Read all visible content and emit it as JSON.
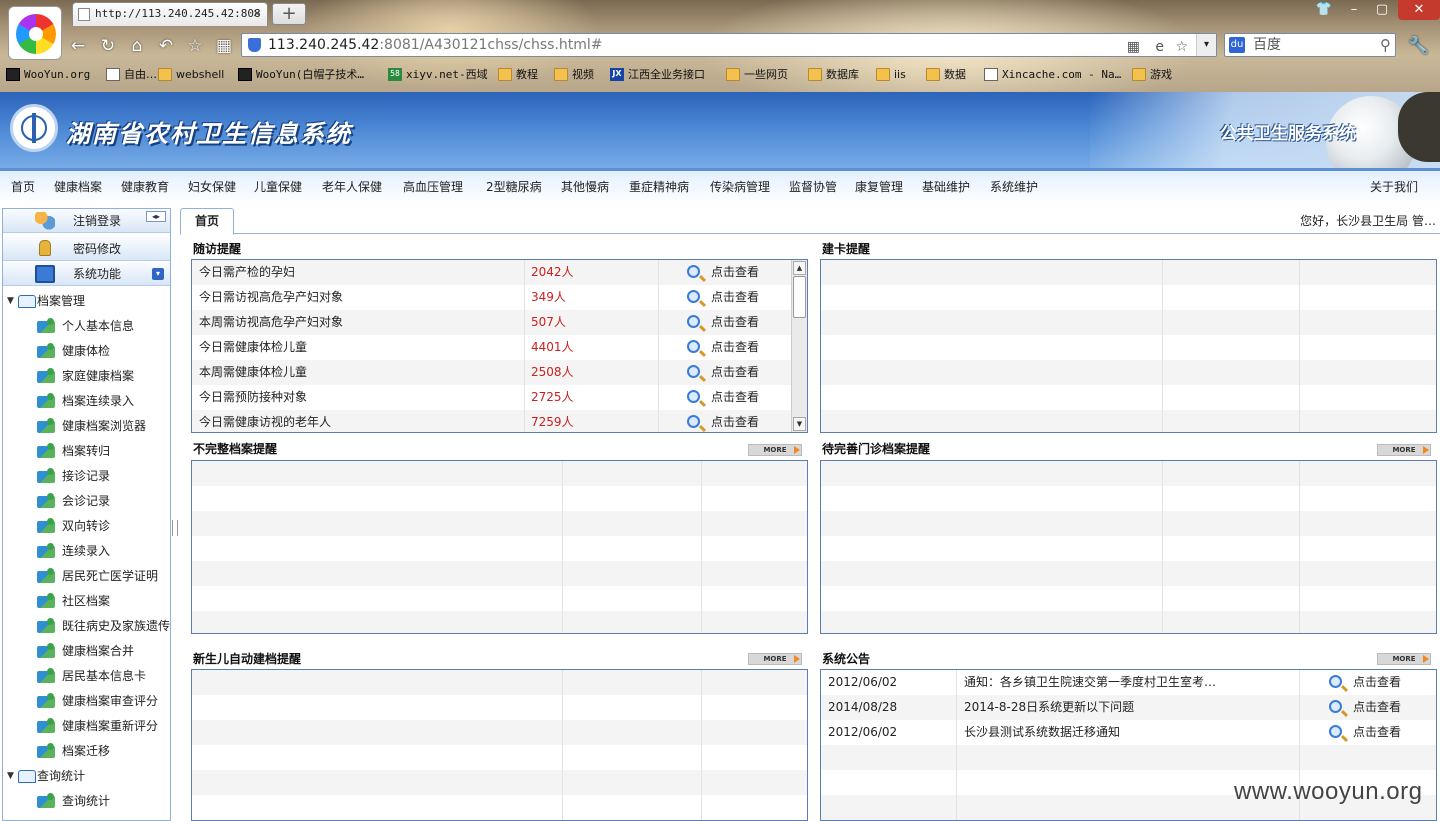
{
  "browser": {
    "tab_title": "http://113.240.245.42:808",
    "tab_close": "✕",
    "new_tab": "+",
    "url_host": "113.240.245.42",
    "url_path": ":8081/A430121chss/chss.html#",
    "search_placeholder": "百度",
    "search_logo": "du",
    "win_buttons": {
      "skin": "👕",
      "minimize": "–",
      "maximize": "▢",
      "close": "✕"
    },
    "nav_icons": {
      "back": "←",
      "reload": "↻",
      "home": "⌂",
      "undo": "↶",
      "favorite": "☆",
      "grid": "▦",
      "wrench": "🔧"
    },
    "addr_icons": {
      "qr": "▦",
      "ie": "e",
      "star": "☆",
      "drop": "▾",
      "mag": "⚲"
    },
    "bookmarks": [
      {
        "label": "WooYun.org",
        "icon": "mono-icon"
      },
      {
        "label": "自由…",
        "icon": "page-icon"
      },
      {
        "label": "webshell",
        "icon": "folder-icon"
      },
      {
        "label": "WooYun(白帽子技术…",
        "icon": "mono-icon"
      },
      {
        "label": "xiyv.net-西域",
        "icon": "number-icon",
        "badge": "58"
      },
      {
        "label": "教程",
        "icon": "folder-icon"
      },
      {
        "label": "视频",
        "icon": "folder-icon"
      },
      {
        "label": "江西全业务接口",
        "icon": "jx-icon",
        "badge": "JX"
      },
      {
        "label": "一些网页",
        "icon": "folder-icon"
      },
      {
        "label": "数据库",
        "icon": "folder-icon"
      },
      {
        "label": "iis",
        "icon": "folder-icon"
      },
      {
        "label": "数据",
        "icon": "folder-icon"
      },
      {
        "label": "Xincache.com - Na…",
        "icon": "page-icon"
      },
      {
        "label": "游戏",
        "icon": "folder-icon"
      }
    ]
  },
  "banner": {
    "title": "湖南省农村卫生信息系统",
    "subtitle": "公共卫生服务系统"
  },
  "menu": {
    "items": [
      "首页",
      "健康档案",
      "健康教育",
      "妇女保健",
      "儿童保健",
      "老年人保健",
      "高血压管理",
      "2型糖尿病",
      "其他慢病",
      "重症精神病",
      "传染病管理",
      "监督协管",
      "康复管理",
      "基础维护",
      "系统维护"
    ],
    "about": "关于我们"
  },
  "sidebar": {
    "buttons": [
      {
        "label": "注销登录",
        "icon": "users-icon"
      },
      {
        "label": "密码修改",
        "icon": "lock-icon"
      },
      {
        "label": "系统功能",
        "icon": "computer-icon"
      }
    ],
    "collapse_arrows": "◂▸",
    "expand_arrow": "▾",
    "tree": [
      {
        "label": "档案管理",
        "level": 0
      },
      {
        "label": "个人基本信息",
        "level": 1
      },
      {
        "label": "健康体检",
        "level": 1
      },
      {
        "label": "家庭健康档案",
        "level": 1
      },
      {
        "label": "档案连续录入",
        "level": 1
      },
      {
        "label": "健康档案浏览器",
        "level": 1
      },
      {
        "label": "档案转归",
        "level": 1
      },
      {
        "label": "接诊记录",
        "level": 1
      },
      {
        "label": "会诊记录",
        "level": 1
      },
      {
        "label": "双向转诊",
        "level": 1
      },
      {
        "label": "连续录入",
        "level": 1
      },
      {
        "label": "居民死亡医学证明",
        "level": 1
      },
      {
        "label": "社区档案",
        "level": 1
      },
      {
        "label": "既往病史及家族遗传",
        "level": 1
      },
      {
        "label": "健康档案合并",
        "level": 1
      },
      {
        "label": "居民基本信息卡",
        "level": 1
      },
      {
        "label": "健康档案审查评分",
        "level": 1
      },
      {
        "label": "健康档案重新评分",
        "level": 1
      },
      {
        "label": "档案迁移",
        "level": 1
      },
      {
        "label": "查询统计",
        "level": 0
      },
      {
        "label": "查询统计",
        "level": 1
      }
    ],
    "toggle_glyph": "▼"
  },
  "main": {
    "tab": "首页",
    "greeting": "您好，长沙县卫生局 管…",
    "more_label": "MORE",
    "panels": {
      "followup": {
        "title": "随访提醒",
        "view_label": "点击查看",
        "rows": [
          {
            "name": "今日需产检的孕妇",
            "count": "2042人"
          },
          {
            "name": "今日需访视高危孕产妇对象",
            "count": "349人"
          },
          {
            "name": "本周需访视高危孕产妇对象",
            "count": "507人"
          },
          {
            "name": "今日需健康体检儿童",
            "count": "4401人"
          },
          {
            "name": "本周需健康体检儿童",
            "count": "2508人"
          },
          {
            "name": "今日需预防接种对象",
            "count": "2725人"
          },
          {
            "name": "今日需健康访视的老年人",
            "count": "7259人"
          }
        ]
      },
      "card": {
        "title": "建卡提醒"
      },
      "incomplete": {
        "title": "不完整档案提醒"
      },
      "outpatient": {
        "title": "待完善门诊档案提醒"
      },
      "newborn": {
        "title": "新生儿自动建档提醒"
      },
      "notice": {
        "title": "系统公告",
        "view_label": "点击查看",
        "rows": [
          {
            "date": "2012/06/02",
            "text": "通知：各乡镇卫生院速交第一季度村卫生室考…"
          },
          {
            "date": "2014/08/28",
            "text": "2014-8-28日系统更新以下问题"
          },
          {
            "date": "2012/06/02",
            "text": "长沙县测试系统数据迁移通知"
          }
        ]
      }
    }
  },
  "watermark": "www.wooyun.org"
}
